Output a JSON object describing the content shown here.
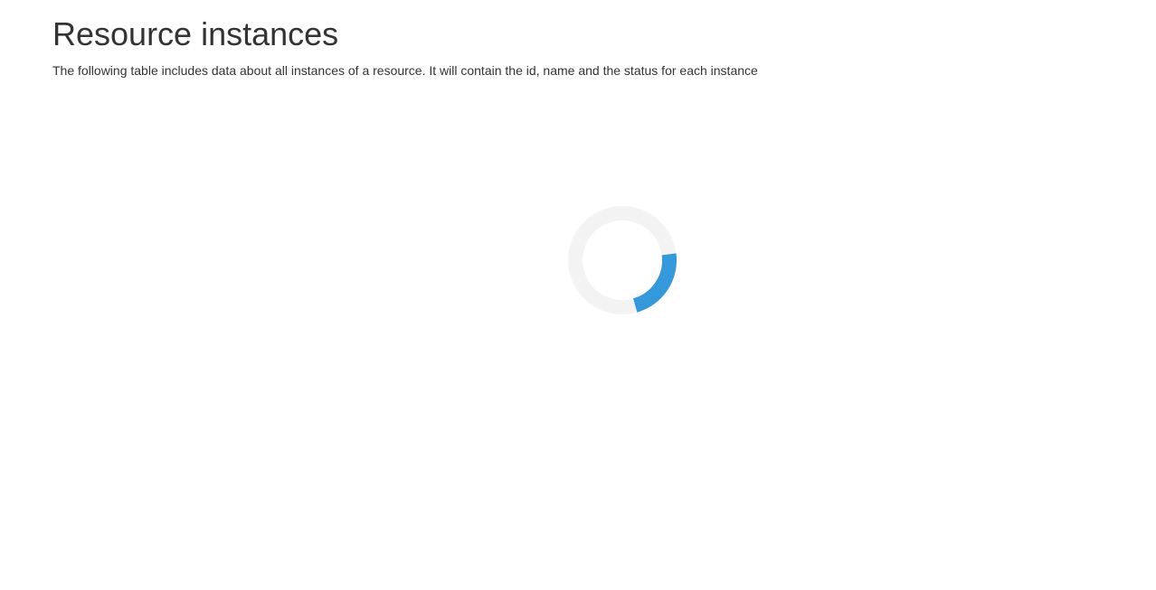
{
  "header": {
    "title": "Resource instances",
    "description": "The following table includes data about all instances of a resource. It will contain the id, name and the status for each instance"
  },
  "loader": {
    "icon": "loading-spinner-icon",
    "track_color": "#f3f3f3",
    "accent_color": "#3498db"
  }
}
